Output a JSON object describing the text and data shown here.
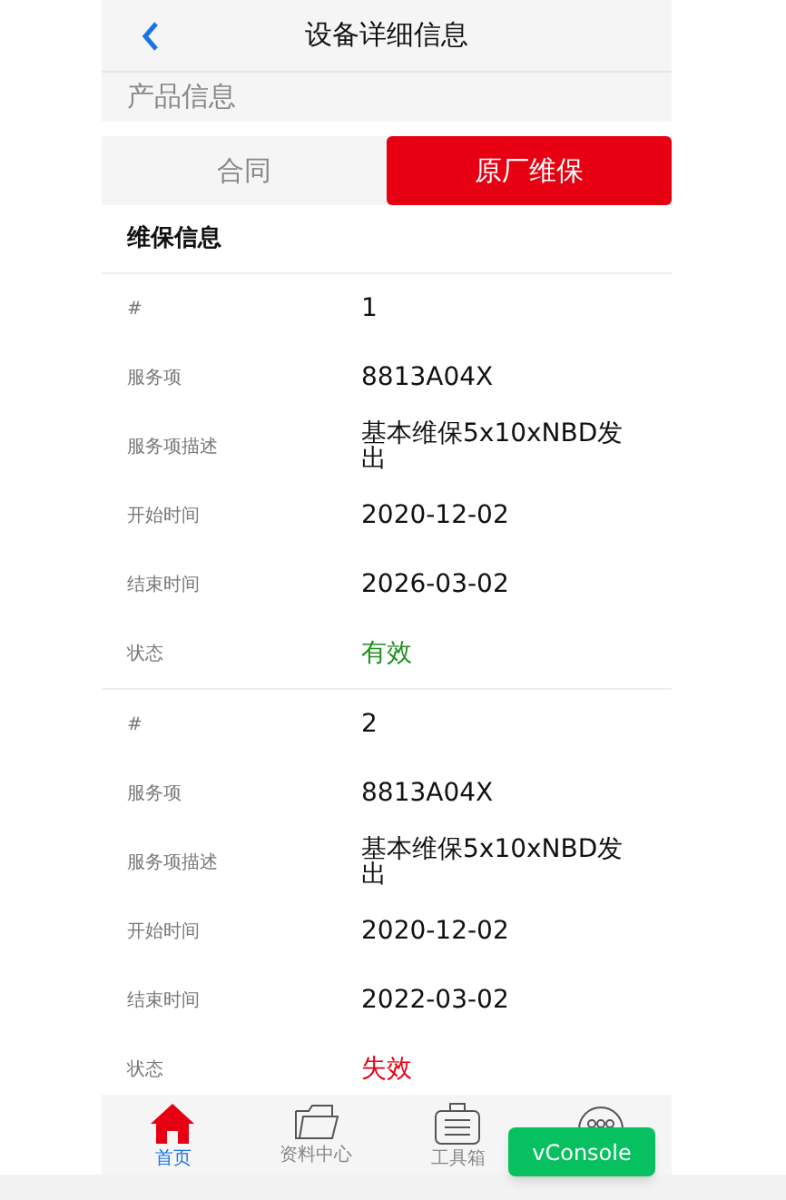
{
  "header": {
    "title": "设备详细信息"
  },
  "section_title": "产品信息",
  "tabs": [
    {
      "label": "合同",
      "selected": false
    },
    {
      "label": "原厂维保",
      "selected": true
    }
  ],
  "panel_title": "维保信息",
  "records": [
    {
      "fields": [
        {
          "label": "#",
          "value": "1"
        },
        {
          "label": "服务项",
          "value": "8813A04X"
        },
        {
          "label": "服务项描述",
          "value": "基本维保5x10xNBD发出"
        },
        {
          "label": "开始时间",
          "value": "2020-12-02"
        },
        {
          "label": "结束时间",
          "value": "2026-03-02"
        }
      ],
      "status_label": "状态",
      "status": "有效",
      "valid": true
    },
    {
      "fields": [
        {
          "label": "#",
          "value": "2"
        },
        {
          "label": "服务项",
          "value": "8813A04X"
        },
        {
          "label": "服务项描述",
          "value": "基本维保5x10xNBD发出"
        },
        {
          "label": "开始时间",
          "value": "2020-12-02"
        },
        {
          "label": "结束时间",
          "value": "2022-03-02"
        }
      ],
      "status_label": "状态",
      "status": "失效",
      "valid": false
    }
  ],
  "nav": [
    {
      "kind": "home",
      "label": "首页",
      "selected": true
    },
    {
      "kind": "folder",
      "label": "资料中心",
      "selected": false
    },
    {
      "kind": "toolbox",
      "label": "工具箱",
      "selected": false
    },
    {
      "kind": "chat",
      "selected": false
    }
  ],
  "console_button": "vConsole"
}
